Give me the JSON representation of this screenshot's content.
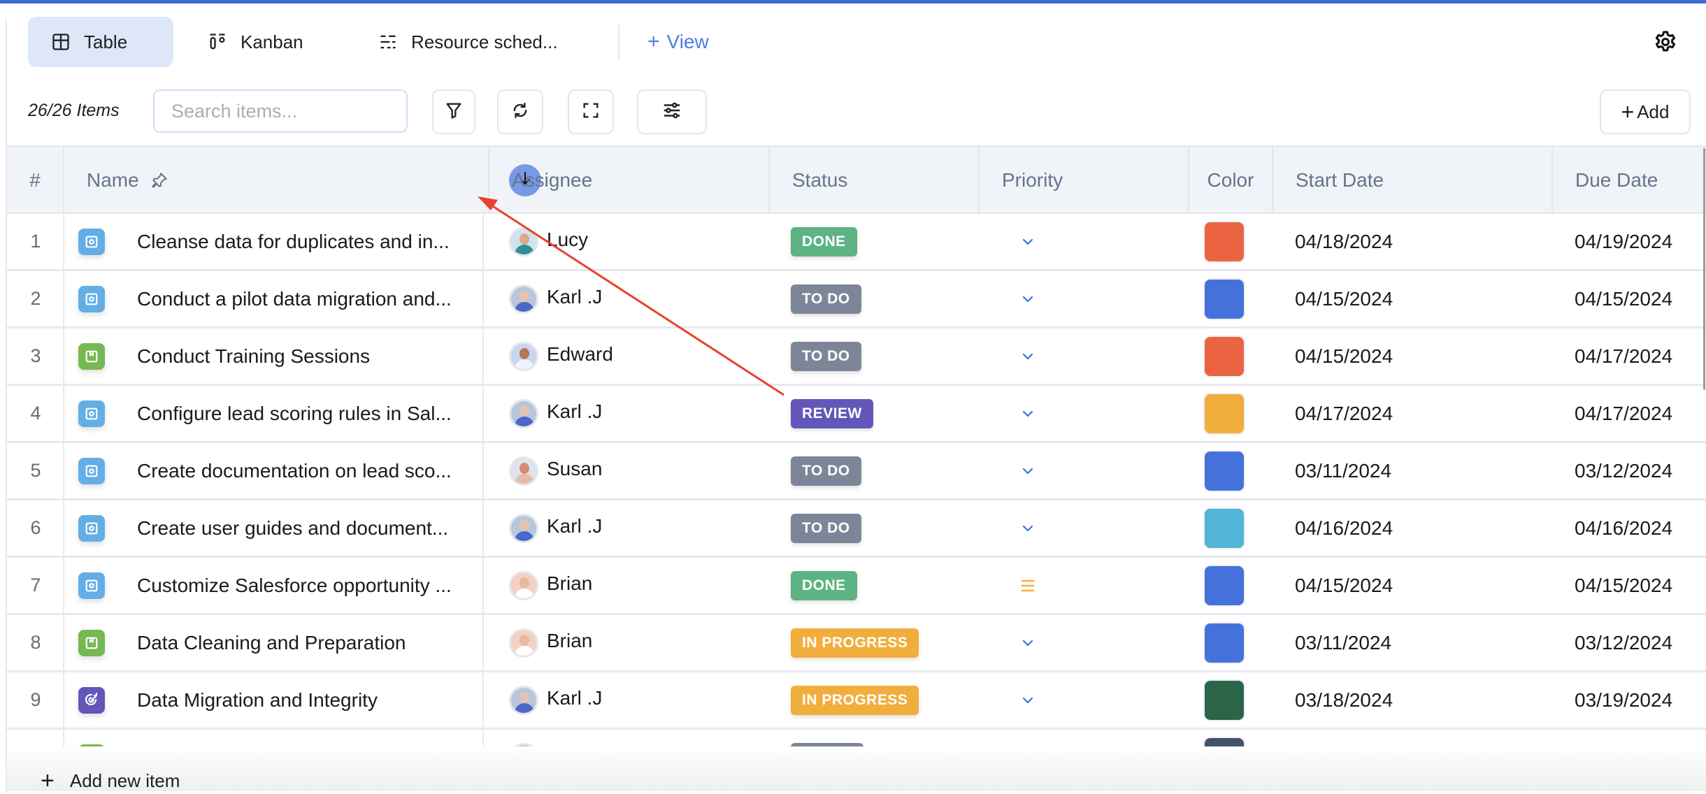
{
  "tabs": [
    {
      "label": "Table",
      "icon": "table-icon",
      "active": true
    },
    {
      "label": "Kanban",
      "icon": "kanban-icon",
      "active": false
    },
    {
      "label": "Resource sched...",
      "icon": "resource-schedule-icon",
      "active": false
    }
  ],
  "add_view_label": "View",
  "toolbar": {
    "item_count": "26/26 Items",
    "search_placeholder": "Search items...",
    "search_value": "",
    "add_label": "Add"
  },
  "table": {
    "columns": [
      "#",
      "Name",
      "Assignee",
      "Status",
      "Priority",
      "Color",
      "Start Date",
      "Due Date"
    ],
    "rows": [
      {
        "num": "1",
        "name": "Cleanse data for duplicates and in...",
        "type": "task",
        "assignee": "Lucy",
        "status": "DONE",
        "priority": "low",
        "color": "#ea6442",
        "start": "04/18/2024",
        "due": "04/19/2024"
      },
      {
        "num": "2",
        "name": "Conduct a pilot data migration and...",
        "type": "task",
        "assignee": "Karl .J",
        "status": "TO DO",
        "priority": "low",
        "color": "#4471db",
        "start": "04/15/2024",
        "due": "04/15/2024"
      },
      {
        "num": "3",
        "name": "Conduct Training Sessions",
        "type": "story",
        "assignee": "Edward",
        "status": "TO DO",
        "priority": "low",
        "color": "#ea6442",
        "start": "04/15/2024",
        "due": "04/17/2024"
      },
      {
        "num": "4",
        "name": "Configure lead scoring rules in Sal...",
        "type": "task",
        "assignee": "Karl .J",
        "status": "REVIEW",
        "priority": "low",
        "color": "#f2ae3d",
        "start": "04/17/2024",
        "due": "04/17/2024"
      },
      {
        "num": "5",
        "name": "Create documentation on lead sco...",
        "type": "task",
        "assignee": "Susan",
        "status": "TO DO",
        "priority": "low",
        "color": "#4471db",
        "start": "03/11/2024",
        "due": "03/12/2024"
      },
      {
        "num": "6",
        "name": "Create user guides and document...",
        "type": "task",
        "assignee": "Karl .J",
        "status": "TO DO",
        "priority": "low",
        "color": "#52b4d6",
        "start": "04/16/2024",
        "due": "04/16/2024"
      },
      {
        "num": "7",
        "name": "Customize Salesforce opportunity ...",
        "type": "task",
        "assignee": "Brian",
        "status": "DONE",
        "priority": "medium",
        "color": "#4471db",
        "start": "04/15/2024",
        "due": "04/15/2024"
      },
      {
        "num": "8",
        "name": "Data Cleaning and Preparation",
        "type": "story",
        "assignee": "Brian",
        "status": "IN PROGRESS",
        "priority": "low",
        "color": "#4471db",
        "start": "03/11/2024",
        "due": "03/12/2024"
      },
      {
        "num": "9",
        "name": "Data Migration and Integrity",
        "type": "epic",
        "assignee": "Karl .J",
        "status": "IN PROGRESS",
        "priority": "low",
        "color": "#2a654a",
        "start": "03/18/2024",
        "due": "03/19/2024"
      },
      {
        "num": "",
        "name": "",
        "type": "story",
        "assignee": "",
        "status": "",
        "status_color_key": "TO DO",
        "priority": "",
        "color": "#44526e",
        "start": "",
        "due": ""
      }
    ]
  },
  "status_colors": {
    "DONE": "#5db383",
    "TO DO": "#7d8699",
    "REVIEW": "#6356b9",
    "IN PROGRESS": "#f2ae3d"
  },
  "type_colors": {
    "task": "#64aee6",
    "story": "#76b852",
    "epic": "#6356b9"
  },
  "avatar_colors": {
    "Lucy": {
      "bg": "#cfe3f0",
      "head": "#d9a98a",
      "body": "#2f8f93"
    },
    "Karl .J": {
      "bg": "#b7c6db",
      "head": "#e6c3b1",
      "body": "#4a67c9"
    },
    "Edward": {
      "bg": "#c7d6f2",
      "head": "#b77554",
      "body": "#eef2fa"
    },
    "Susan": {
      "bg": "#dde4ee",
      "head": "#d98a78",
      "body": "#e9b9a6"
    },
    "Brian": {
      "bg": "#f3d0c2",
      "head": "#e8b9a0",
      "body": "#ffffff"
    }
  },
  "priority_colors": {
    "low": "#3b6fe0",
    "medium": "#f2ae3d"
  },
  "footer": {
    "add_new_item_label": "Add new item"
  }
}
